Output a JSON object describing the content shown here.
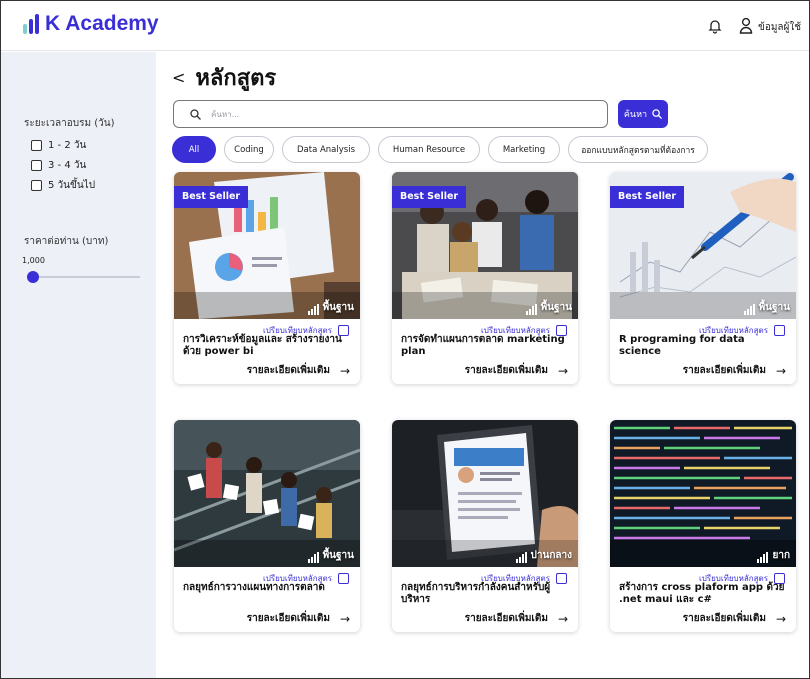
{
  "app": {
    "logo_text": "K Academy",
    "brand_color": "#3a2fd6"
  },
  "header": {
    "bell_icon": "bell-icon",
    "user_icon": "user-icon",
    "user_label": "ข้อมูลผู้ใช้"
  },
  "sidebar": {
    "duration_title": "ระยะเวลาอบรม (วัน)",
    "duration_options": [
      {
        "label": "1 - 2  วัน",
        "checked": false
      },
      {
        "label": "3 - 4  วัน",
        "checked": false
      },
      {
        "label": "5  วันขึ้นไป",
        "checked": false
      }
    ],
    "price_title": "ราคาต่อท่าน (บาท)",
    "price_value": "1,000"
  },
  "main": {
    "back_icon": "chevron-left-icon",
    "page_title": "หลักสูตร",
    "search": {
      "placeholder": "ค้นหา...",
      "button_label": "ค้นหา"
    },
    "chips": [
      {
        "label": "All",
        "active": true
      },
      {
        "label": "Coding",
        "active": false
      },
      {
        "label": "Data Analysis",
        "active": false
      },
      {
        "label": "Human Resource",
        "active": false
      },
      {
        "label": "Marketing",
        "active": false
      },
      {
        "label": "ออกแบบหลักสูตรตามที่ต้องการ",
        "active": false
      }
    ],
    "compare_label": "เปรียบเทียบหลักสูตร",
    "more_label": "รายละเอียดเพิ่มเติม",
    "badge_label": "Best Seller",
    "courses": [
      {
        "title": "การวิเคราะห์ข้อมูลและ สร้างรายงานด้วย power bi",
        "level": "พื้นฐาน",
        "best_seller": true
      },
      {
        "title": "การจัดทำแผนการตลาด marketing plan",
        "level": "พื้นฐาน",
        "best_seller": true
      },
      {
        "title": "R programing for data science",
        "level": "พื้นฐาน",
        "best_seller": true
      },
      {
        "title": "กลยุทธ์การวางแผนทางการตลาด",
        "level": "พื้นฐาน",
        "best_seller": false
      },
      {
        "title": "กลยุทธ์การบริหารกำลังคนสำหรับผู้บริหาร",
        "level": "ปานกลาง",
        "best_seller": false
      },
      {
        "title": "สร้างการ cross plaform app ด้วย .net maui และ c#",
        "level": "ยาก",
        "best_seller": false
      }
    ]
  }
}
